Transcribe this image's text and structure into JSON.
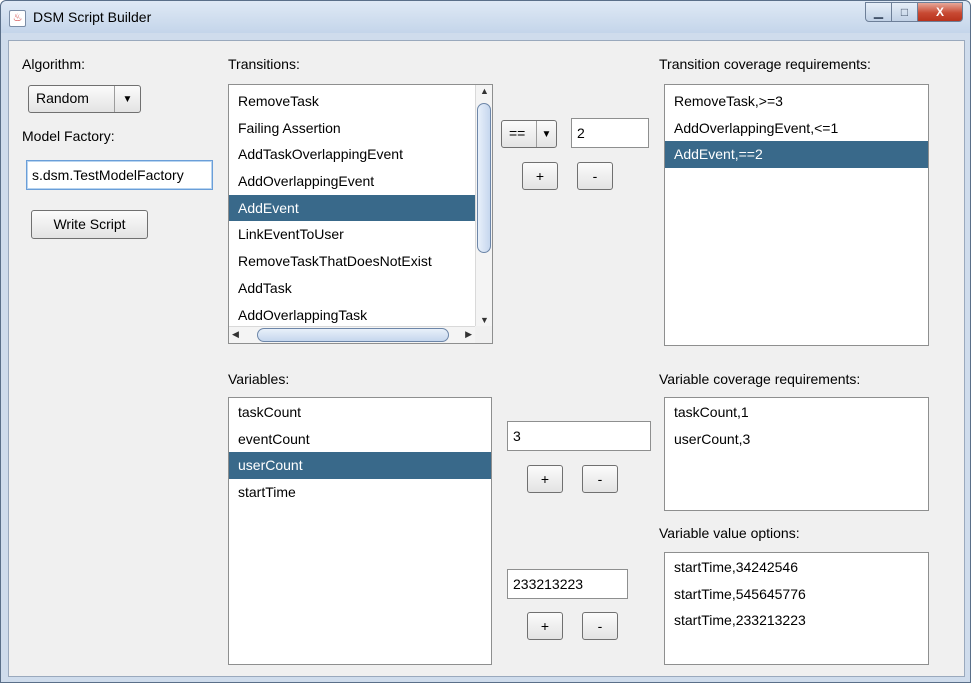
{
  "window": {
    "title": "DSM Script Builder",
    "minimize": "▁",
    "maximize": "□",
    "close": "X"
  },
  "left": {
    "algorithm_label": "Algorithm:",
    "algorithm_value": "Random",
    "model_factory_label": "Model Factory:",
    "model_factory_value": "s.dsm.TestModelFactory",
    "write_script": "Write Script"
  },
  "transitions": {
    "label": "Transitions:",
    "items": [
      "RemoveTask",
      "Failing Assertion",
      "AddTaskOverlappingEvent",
      "AddOverlappingEvent",
      "AddEvent",
      "LinkEventToUser",
      "RemoveTaskThatDoesNotExist",
      "AddTask",
      "AddOverlappingTask"
    ],
    "selected_index": 4,
    "operator": "==",
    "count_value": "2",
    "add": "+",
    "remove": "-"
  },
  "transition_requirements": {
    "label": "Transition coverage requirements:",
    "items": [
      "RemoveTask,>=3",
      "AddOverlappingEvent,<=1",
      "AddEvent,==2"
    ],
    "selected_index": 2
  },
  "variables": {
    "label": "Variables:",
    "items": [
      "taskCount",
      "eventCount",
      "userCount",
      "startTime"
    ],
    "selected_index": 2,
    "coverage_value": "3",
    "option_value": "233213223",
    "add": "+",
    "remove": "-"
  },
  "variable_requirements": {
    "label": "Variable coverage requirements:",
    "items": [
      "taskCount,1",
      "userCount,3"
    ]
  },
  "variable_options": {
    "label": "Variable value options:",
    "items": [
      "startTime,34242546",
      "startTime,545645776",
      "startTime,233213223"
    ]
  },
  "icons": {
    "app": "java-cup-icon",
    "dropdown": "chevron-down-icon",
    "scroll_up": "arrow-up-icon",
    "scroll_down": "arrow-down-icon",
    "scroll_left": "arrow-left-icon",
    "scroll_right": "arrow-right-icon"
  },
  "colors": {
    "selection": "#39698a",
    "background": "#f0f0f0",
    "titlebar": "#cfdcec"
  }
}
